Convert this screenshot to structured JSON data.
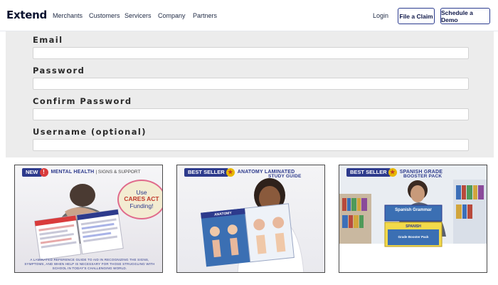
{
  "brand": {
    "logo_text": "Extend"
  },
  "nav": {
    "links": [
      "Merchants",
      "Customers",
      "Servicers",
      "Company",
      "Partners"
    ],
    "login": "Login",
    "file_claim": "File a Claim",
    "schedule_demo": "Schedule a Demo"
  },
  "form": {
    "fields": [
      {
        "label": "Email",
        "value": ""
      },
      {
        "label": "Password",
        "value": ""
      },
      {
        "label": "Confirm Password",
        "value": ""
      },
      {
        "label": "Username (optional)",
        "value": ""
      }
    ]
  },
  "products": [
    {
      "badge": "NEW",
      "badge_icon": "exclamation-icon",
      "title": "MENTAL HEALTH",
      "subtitle": "| SIGNS & SUPPORT",
      "callout_line1": "Use",
      "callout_line2": "CARES ACT",
      "callout_line3": "Funding!",
      "caption": "A LAMINATED REFERENCE GUIDE TO AID IN RECOGNIZING THE SIGNS, SYMPTOMS, AND WHEN HELP IS NECESSARY FOR THOSE STRUGGLING WITH SCHOOL IN TODAY'S CHALLENGING WORLD.",
      "book_title": "MENTAL HEALTH"
    },
    {
      "badge": "BEST SELLER",
      "badge_icon": "star-icon",
      "title": "ANATOMY LAMINATED",
      "title_line2": "STUDY GUIDE",
      "book_title": "ANATOMY"
    },
    {
      "badge": "BEST SELLER",
      "badge_icon": "star-icon",
      "title": "SPANISH GRADE",
      "title_line2": "BOOSTER PACK",
      "book_title": "Spanish Grammar",
      "book_title_2": "SPANISH",
      "book_title_3": "Grade Booster Pack"
    }
  ],
  "colors": {
    "brand_navy": "#2d3a8c",
    "form_bg": "#ececec",
    "accent_pink": "#e06b8c",
    "badge_gold": "#e8b800"
  }
}
